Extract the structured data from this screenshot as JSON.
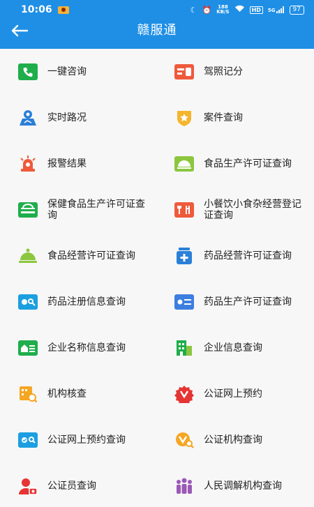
{
  "status": {
    "time": "10:06",
    "speed_top": "188",
    "speed_bottom": "KB/S",
    "hd": "HD",
    "signal": "5G",
    "battery": "97"
  },
  "header": {
    "title": "赣服通"
  },
  "colors": {
    "header": "#1f8fe6",
    "background": "#f7f7f7"
  },
  "services": [
    {
      "label": "一键咨询",
      "icon": "phone-icon"
    },
    {
      "label": "驾照记分",
      "icon": "license-card-icon"
    },
    {
      "label": "实时路况",
      "icon": "map-road-icon"
    },
    {
      "label": "案件查询",
      "icon": "police-badge-icon"
    },
    {
      "label": "报警结果",
      "icon": "alarm-siren-icon"
    },
    {
      "label": "食品生产许可证查询",
      "icon": "food-production-icon"
    },
    {
      "label": "保健食品生产许可证查询",
      "icon": "health-food-icon"
    },
    {
      "label": "小餐饮小食杂经营登记证查询",
      "icon": "small-catering-icon"
    },
    {
      "label": "食品经营许可证查询",
      "icon": "food-cloche-icon"
    },
    {
      "label": "药品经营许可证查询",
      "icon": "medicine-box-icon"
    },
    {
      "label": "药品注册信息查询",
      "icon": "drug-register-icon"
    },
    {
      "label": "药品生产许可证查询",
      "icon": "drug-production-icon"
    },
    {
      "label": "企业名称信息查询",
      "icon": "enterprise-name-icon"
    },
    {
      "label": "企业信息查询",
      "icon": "building-icon"
    },
    {
      "label": "机构核查",
      "icon": "institution-check-icon"
    },
    {
      "label": "公证网上预约",
      "icon": "notary-appointment-icon"
    },
    {
      "label": "公证网上预约查询",
      "icon": "notary-query-icon"
    },
    {
      "label": "公证机构查询",
      "icon": "notary-agency-icon"
    },
    {
      "label": "公证员查询",
      "icon": "notary-person-icon"
    },
    {
      "label": "人民调解机构查询",
      "icon": "mediation-people-icon"
    }
  ]
}
